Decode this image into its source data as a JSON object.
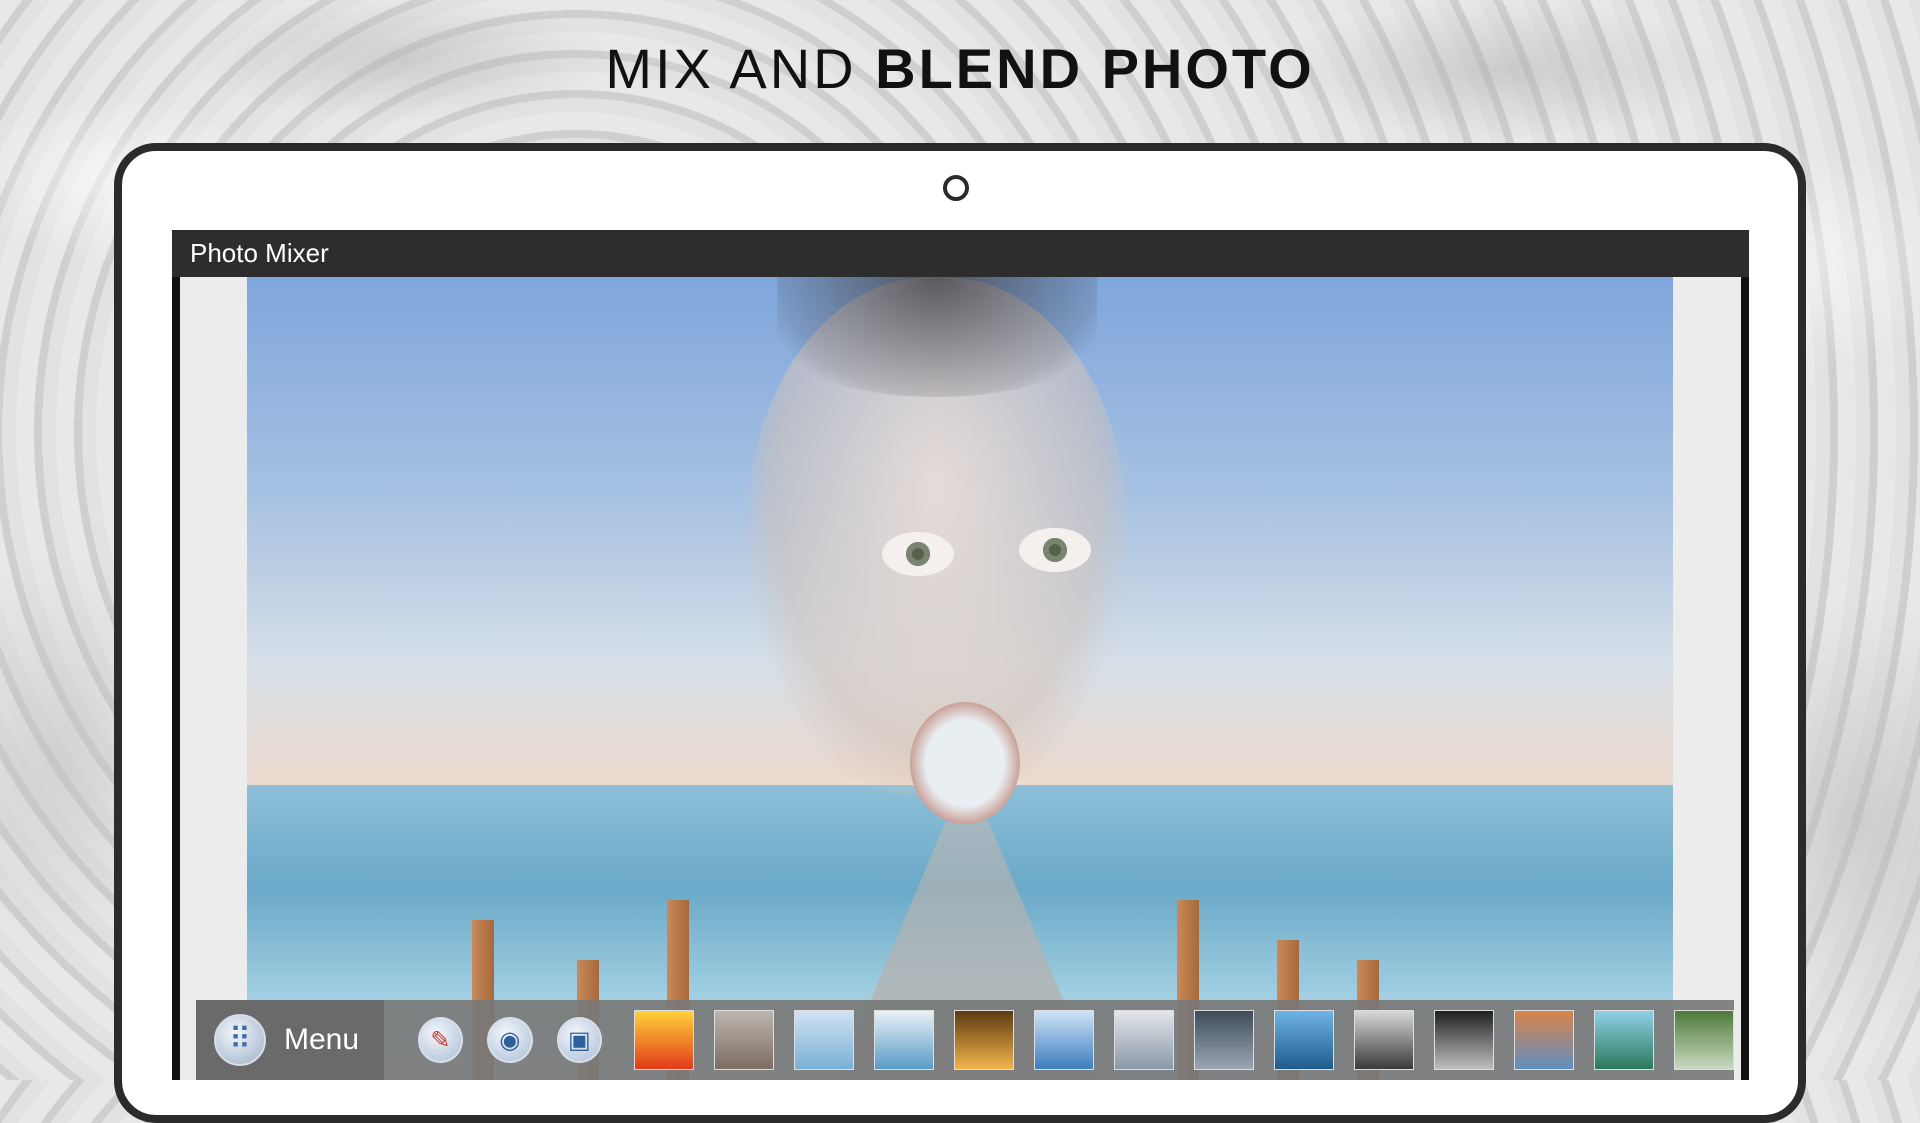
{
  "headline": {
    "light": "MIX AND",
    "bold": "BLEND PHOTO"
  },
  "window": {
    "title": "Photo Mixer"
  },
  "toolbar": {
    "menu_icon": "apps-grid-icon",
    "menu_label": "Menu",
    "tools": [
      {
        "name": "edit-icon",
        "glyph": "✎"
      },
      {
        "name": "camera-icon",
        "glyph": "📷"
      },
      {
        "name": "gallery-icon",
        "glyph": "🖼"
      }
    ],
    "thumbnails": [
      {
        "name": "thumb-sunset",
        "colors": [
          "#ffd23a",
          "#e23a1a"
        ]
      },
      {
        "name": "thumb-mountains",
        "colors": [
          "#bdb6ae",
          "#7d6c62"
        ]
      },
      {
        "name": "thumb-pier",
        "colors": [
          "#cfe2f3",
          "#7ab0d6"
        ]
      },
      {
        "name": "thumb-beach-clouds",
        "colors": [
          "#e9f1f7",
          "#5a9bc8"
        ]
      },
      {
        "name": "thumb-lit-room",
        "colors": [
          "#5b3a10",
          "#f2b44a"
        ]
      },
      {
        "name": "thumb-swan",
        "colors": [
          "#cde3f5",
          "#3d7ec0"
        ]
      },
      {
        "name": "thumb-lighthouse-winter",
        "colors": [
          "#e3e6ea",
          "#8a98a8"
        ]
      },
      {
        "name": "thumb-dark-pier",
        "colors": [
          "#3e4b58",
          "#9aa6b3"
        ]
      },
      {
        "name": "thumb-blue-pier",
        "colors": [
          "#6fb4e4",
          "#1f5c8e"
        ]
      },
      {
        "name": "thumb-bw-waterfall",
        "colors": [
          "#d8d8d8",
          "#3a3a3a"
        ]
      },
      {
        "name": "thumb-city-night",
        "colors": [
          "#202020",
          "#bfbfbf"
        ]
      },
      {
        "name": "thumb-desert-road",
        "colors": [
          "#d9844a",
          "#5f8fc0"
        ]
      },
      {
        "name": "thumb-waterfall",
        "colors": [
          "#8fd0ea",
          "#2c7a5a"
        ]
      },
      {
        "name": "thumb-forest-stream",
        "colors": [
          "#4f7a3a",
          "#c9d9c0"
        ]
      }
    ]
  }
}
